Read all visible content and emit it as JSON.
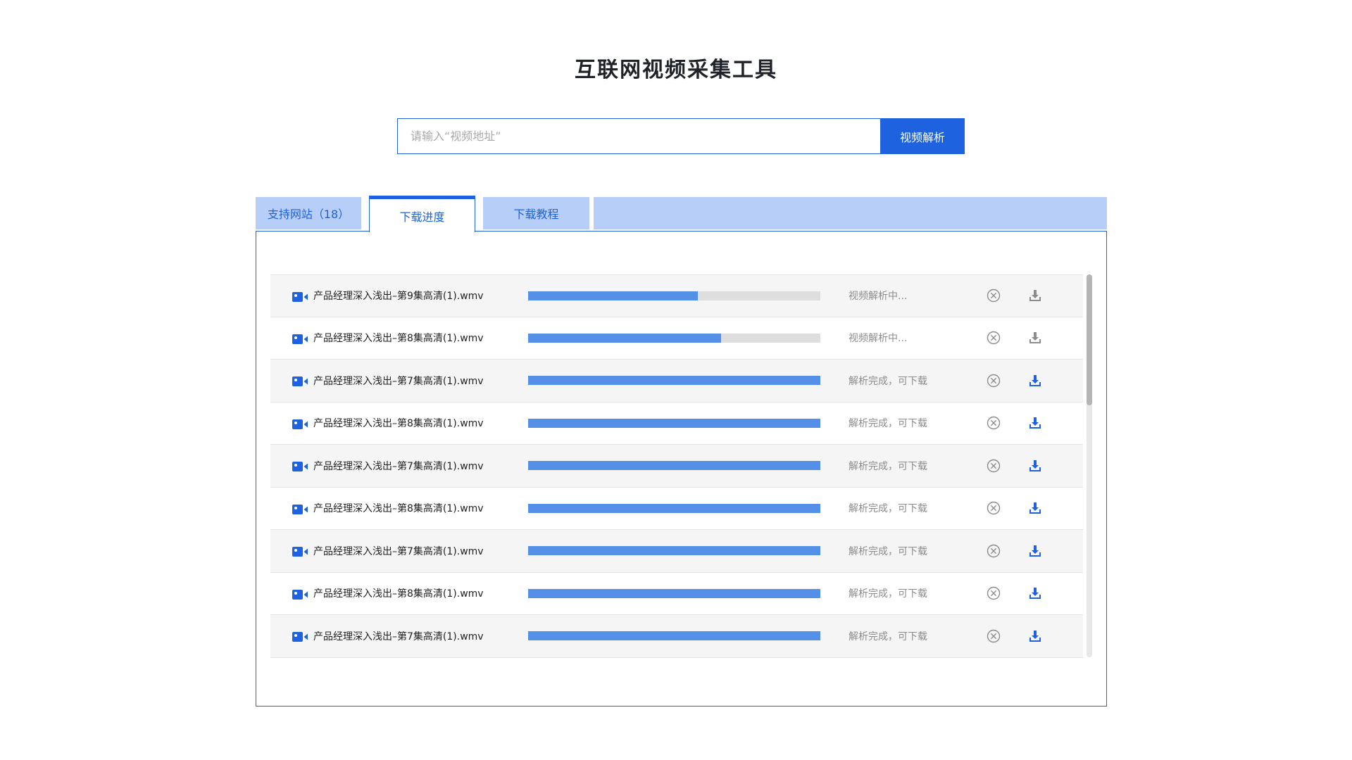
{
  "header": {
    "title": "互联网视频采集工具"
  },
  "search": {
    "placeholder": "请输入“视频地址”",
    "value": "",
    "button_label": "视频解析"
  },
  "tabs": [
    {
      "label": "支持网站（18）",
      "active": false
    },
    {
      "label": "下载进度",
      "active": true
    },
    {
      "label": "下载教程",
      "active": false
    }
  ],
  "downloads": {
    "items": [
      {
        "file_name": "产品经理深入浅出–第9集高清(1).wmv",
        "progress": 0.58,
        "status": "视频解析中...",
        "state": "parsing"
      },
      {
        "file_name": "产品经理深入浅出–第8集高清(1).wmv",
        "progress": 0.66,
        "status": "视频解析中...",
        "state": "parsing"
      },
      {
        "file_name": "产品经理深入浅出–第7集高清(1).wmv",
        "progress": 1.0,
        "status": "解析完成，可下载",
        "state": "done"
      },
      {
        "file_name": "产品经理深入浅出–第8集高清(1).wmv",
        "progress": 1.0,
        "status": "解析完成，可下载",
        "state": "done"
      },
      {
        "file_name": "产品经理深入浅出–第7集高清(1).wmv",
        "progress": 1.0,
        "status": "解析完成，可下载",
        "state": "done"
      },
      {
        "file_name": "产品经理深入浅出–第8集高清(1).wmv",
        "progress": 1.0,
        "status": "解析完成，可下载",
        "state": "done"
      },
      {
        "file_name": "产品经理深入浅出–第7集高清(1).wmv",
        "progress": 1.0,
        "status": "解析完成，可下载",
        "state": "done"
      },
      {
        "file_name": "产品经理深入浅出–第8集高清(1).wmv",
        "progress": 1.0,
        "status": "解析完成，可下载",
        "state": "done"
      },
      {
        "file_name": "产品经理深入浅出–第7集高清(1).wmv",
        "progress": 1.0,
        "status": "解析完成，可下载",
        "state": "done"
      }
    ]
  },
  "icons": {
    "file": "video-camera-icon",
    "cancel": "cancel-circle-icon",
    "download": "download-tray-icon"
  },
  "colors": {
    "primary": "#1f62e0",
    "tab_inactive": "#b6cef8",
    "progress_fill": "#5590e8",
    "progress_track": "#dedede",
    "download_disabled": "#8c8c8c"
  }
}
